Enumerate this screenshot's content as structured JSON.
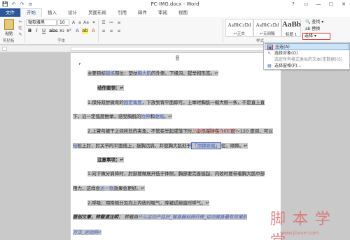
{
  "window": {
    "title": "PC-IMG.docx - Word",
    "controls": [
      "?",
      "▭",
      "—",
      "▢",
      "✕"
    ]
  },
  "qat": [
    "💾",
    "↶",
    "↷",
    "≡"
  ],
  "tabs": [
    "文件",
    "开始",
    "插入",
    "设计",
    "页面布局",
    "引用",
    "邮件",
    "审阅",
    "视图"
  ],
  "ribbon": {
    "clipboard": {
      "paste": "粘贴",
      "label": "剪贴板"
    },
    "font": {
      "name": "微软雅黑",
      "size": "10",
      "label": "字体"
    },
    "styles": {
      "items": [
        {
          "sample": "AaBbCcDd",
          "name": "↵正文"
        },
        {
          "sample": "AaBbCcDd",
          "name": "↵无间隔"
        },
        {
          "sample": "AaBb",
          "name": "标题 1"
        }
      ],
      "label": "样式"
    },
    "editing": {
      "find": "🔍 查找 ▾",
      "replace": "ab 替换",
      "select": "选择 ▾"
    }
  },
  "menu": {
    "items": [
      {
        "icon": "▣",
        "label": "全选(A)"
      },
      {
        "icon": "↖",
        "label": "选择对象(O)"
      },
      {
        "icon": "",
        "label": "选定所有格式类似的文本(无数据)(S)"
      },
      {
        "icon": "▤",
        "label": "选择窗格(P)..."
      }
    ]
  },
  "document": {
    "l1": "↵",
    "l2a": "主要目标",
    "l2b": "锻炼",
    "l2c": "部位：塑扶",
    "l2d": "胸大肌",
    "l2e": "的外侧、下缘沟、提举和形态。↵",
    "l3": "动作要领：↵",
    "l4a": "1.保持双肘微弯的",
    "l4b": "固定角度",
    "l4c": "，下放到背平面即可，上举时胸肌一缩大侧一条，不是直上直",
    "l5a": "下，沿一定弧度推举，感受胸肌的",
    "l5b": "拉伸",
    "l5c": "和",
    "l5d": "收缩",
    "l5e": "。↵",
    "l6": "2.上臂与躯干之间所处的夹角，不管在举起或落下时，必须保持在 100 度～120 度间，可以",
    "l7a": "轻",
    "l7b": "松上肘，肘关节的平面线上，挺胸沉肩，并使胸大肌处于",
    "l7c": "「顶撑收缩」",
    "l7d": "位，顺降。↵",
    "l8": "注意事项：↵",
    "l9": "1.向下做分肩降时，肘部要做展开低于体侧，胸部要完善挺起，内收时要带着胸大肌中部",
    "l10a": "用力，这样会",
    "l10b": "达一致",
    "l10c": "效果会更好。↵",
    "l11": "2.呼吸：用降侧分及向上内收时吸气，降被近掉直时呼气。↵",
    "l12a": "原创文章，转载请注明：",
    "l12b": " 转载自",
    "l12c": "什么运动产品好_健身器材排行榜_运动健身最有效果的",
    "l13": "方法_运动网↵"
  },
  "watermark": {
    "url": "www.jbxue.com",
    "cn": "脚本学堂",
    "bottom": "www.jbxue.com"
  },
  "colors": {
    "accent": "#2b579a",
    "highlight": "#c6c6c6",
    "link": "#3b5ccc",
    "callout": "#d9322a",
    "menu_selected": "#cde4f7"
  }
}
